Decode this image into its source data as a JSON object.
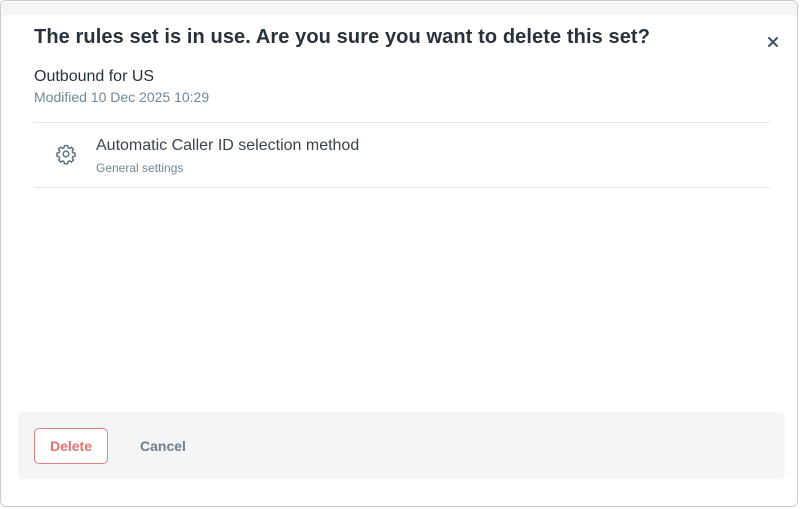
{
  "dialog": {
    "title": "The rules set is in use. Are you sure you want to delete this set?",
    "close_icon": "close-icon"
  },
  "rules_set": {
    "name": "Outbound for US",
    "modified": "Modified 10 Dec 2025 10:29"
  },
  "usage": [
    {
      "icon": "gear-icon",
      "title": "Automatic Caller ID selection method",
      "subtitle": "General settings"
    }
  ],
  "footer": {
    "delete_label": "Delete",
    "cancel_label": "Cancel"
  },
  "colors": {
    "title_text": "#28323c",
    "muted_text": "#6f8797",
    "danger": "#e2736c",
    "footer_bg": "#f3f5f7"
  }
}
